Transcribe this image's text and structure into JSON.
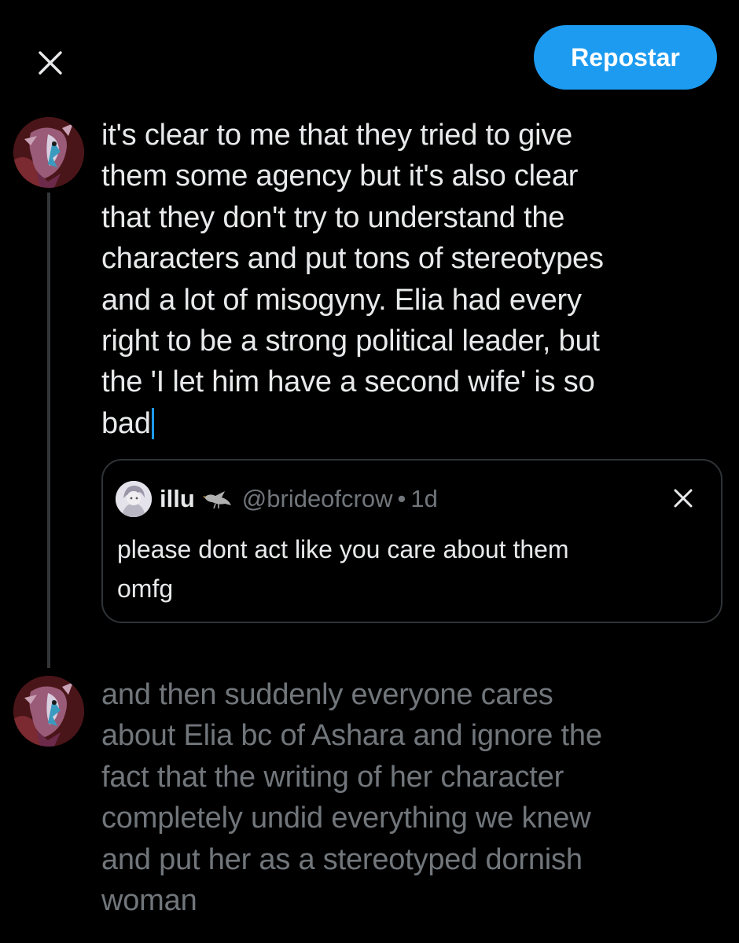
{
  "header": {
    "close_icon": "close-icon",
    "repost_label": "Repostar",
    "accent": "#1d9bf0"
  },
  "thread": {
    "post1": {
      "avatar_icon": "avatar",
      "text": "it's clear to me that they tried to give\nthem some agency but it's also clear\nthat they don't try to understand the\ncharacters and put tons of stereotypes\nand a lot of misogyny. Elia had every\nright to be a strong political leader, but\nthe 'I let him have a second wife' is so\nbad"
    },
    "quote": {
      "name": "illu",
      "badge_icon": "crow-icon",
      "handle": "@brideofcrow",
      "separator": "•",
      "time": "1d",
      "text": "please dont act like you care about them\nomfg",
      "close_icon": "close-icon"
    },
    "post2": {
      "avatar_icon": "avatar",
      "text": "and then suddenly everyone cares\nabout Elia bc of Ashara and ignore the\nfact that the writing of her character\ncompletely undid everything we knew\nand put her as a stereotyped dornish\nwoman"
    }
  },
  "colors": {
    "background": "#000000",
    "text_primary": "#e7e9ea",
    "text_secondary": "#71767b",
    "border": "#2f3336"
  }
}
